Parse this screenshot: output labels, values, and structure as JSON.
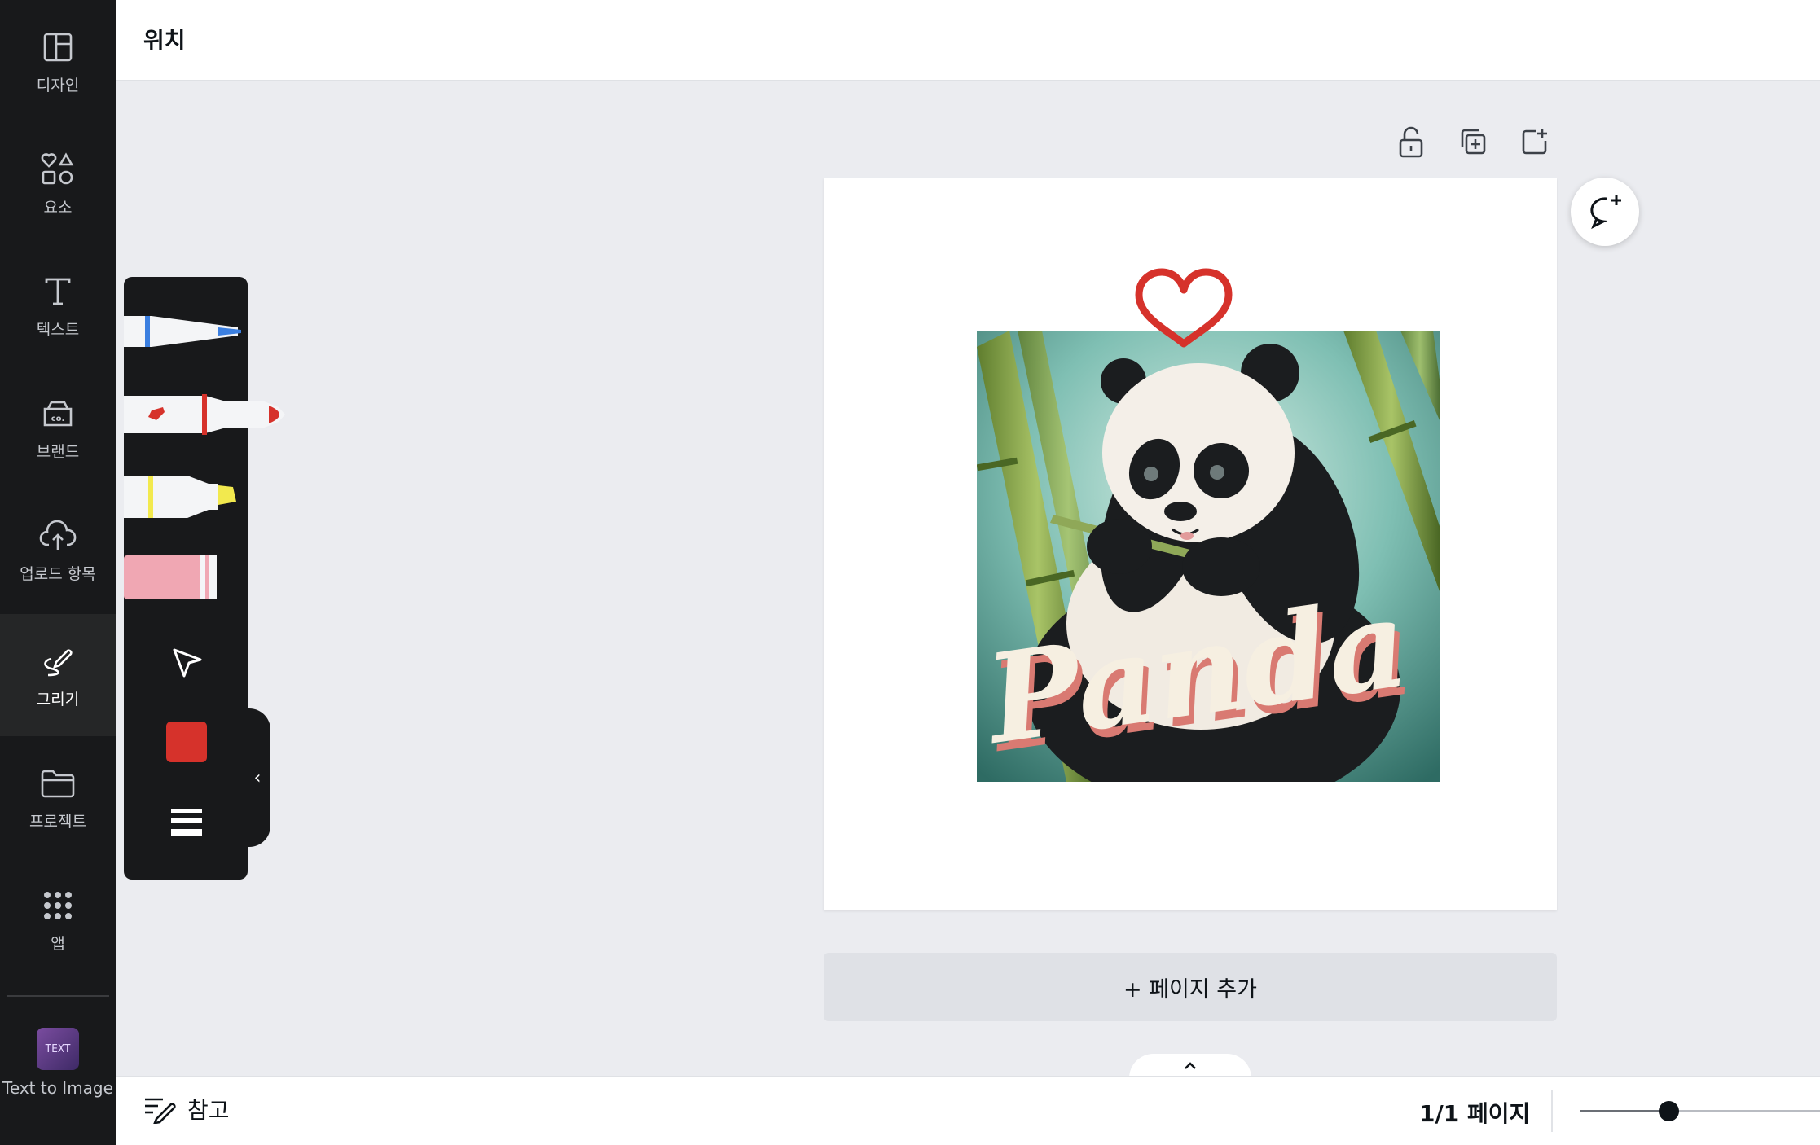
{
  "topbar": {
    "title": "위치"
  },
  "rail": {
    "items": [
      {
        "label": "디자인",
        "icon": "layout-icon"
      },
      {
        "label": "요소",
        "icon": "shapes-icon"
      },
      {
        "label": "텍스트",
        "icon": "text-icon"
      },
      {
        "label": "브랜드",
        "icon": "brand-icon"
      },
      {
        "label": "업로드 항목",
        "icon": "upload-icon"
      },
      {
        "label": "그리기",
        "icon": "draw-icon"
      },
      {
        "label": "프로젝트",
        "icon": "folder-icon"
      },
      {
        "label": "앱",
        "icon": "apps-icon"
      }
    ],
    "text_to_image": {
      "label": "Text to Image",
      "thumb_text": "TEXT"
    }
  },
  "draw_panel": {
    "tools": [
      "pen",
      "marker",
      "highlighter",
      "eraser"
    ],
    "pen_color": "#3b7fe0",
    "marker_color": "#d6322b",
    "highlighter_color": "#f2e94e",
    "eraser_color": "#f0a7b3",
    "selected_color": "#d6322b"
  },
  "canvas": {
    "image_text": "Panda",
    "heart_color": "#d6322b",
    "add_page_label": "+ 페이지 추가"
  },
  "bottombar": {
    "notes_label": "참고",
    "page_count": "1/1 페이지",
    "zoom_fraction": 0.37
  }
}
